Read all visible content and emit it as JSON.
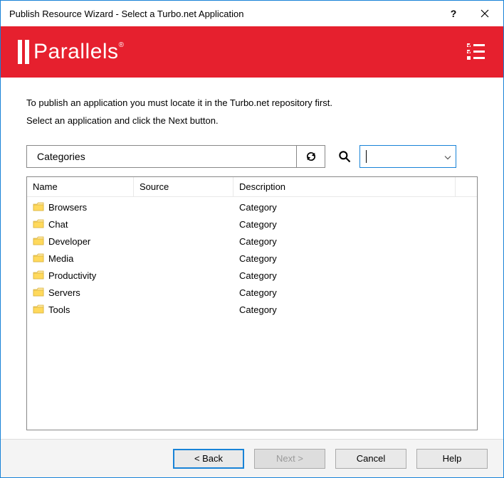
{
  "window": {
    "title": "Publish Resource Wizard - Select a Turbo.net Application"
  },
  "brand": {
    "name": "Parallels"
  },
  "instructions": {
    "line1": "To publish an application you must locate it in the Turbo.net repository first.",
    "line2": "Select an application and click the Next button."
  },
  "breadcrumb": {
    "path": "Categories"
  },
  "search": {
    "value": ""
  },
  "list": {
    "columns": {
      "name": "Name",
      "source": "Source",
      "description": "Description"
    },
    "rows": [
      {
        "name": "Browsers",
        "source": "",
        "description": "Category"
      },
      {
        "name": "Chat",
        "source": "",
        "description": "Category"
      },
      {
        "name": "Developer",
        "source": "",
        "description": "Category"
      },
      {
        "name": "Media",
        "source": "",
        "description": "Category"
      },
      {
        "name": "Productivity",
        "source": "",
        "description": "Category"
      },
      {
        "name": "Servers",
        "source": "",
        "description": "Category"
      },
      {
        "name": "Tools",
        "source": "",
        "description": "Category"
      }
    ]
  },
  "buttons": {
    "back": "< Back",
    "next": "Next >",
    "cancel": "Cancel",
    "help": "Help"
  }
}
